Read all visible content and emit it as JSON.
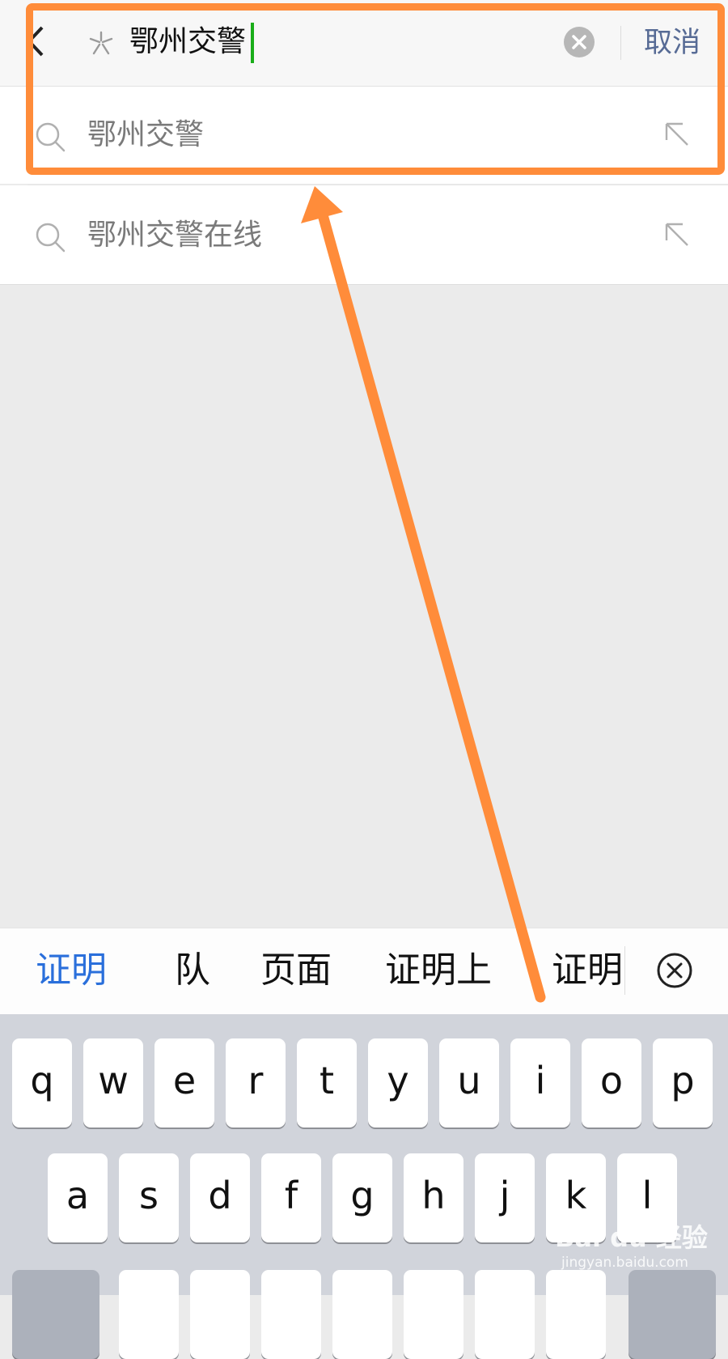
{
  "search": {
    "query": "鄂州交警",
    "cancel_label": "取消"
  },
  "suggestions": [
    {
      "text": "鄂州交警"
    },
    {
      "text": "鄂州交警在线"
    }
  ],
  "candidates": [
    "证明",
    "队",
    "页面",
    "证明上",
    "证明"
  ],
  "keyboard": {
    "row1": [
      "q",
      "w",
      "e",
      "r",
      "t",
      "y",
      "u",
      "i",
      "o",
      "p"
    ],
    "row2": [
      "a",
      "s",
      "d",
      "f",
      "g",
      "h",
      "j",
      "k",
      "l"
    ]
  },
  "watermark": {
    "brand": "Bai du 经验",
    "url": "jingyan.baidu.com"
  },
  "colors": {
    "annotation": "#ff8c3a",
    "candidate_active": "#2a6fdb",
    "cancel": "#576b95",
    "cursor": "#1aad19"
  }
}
